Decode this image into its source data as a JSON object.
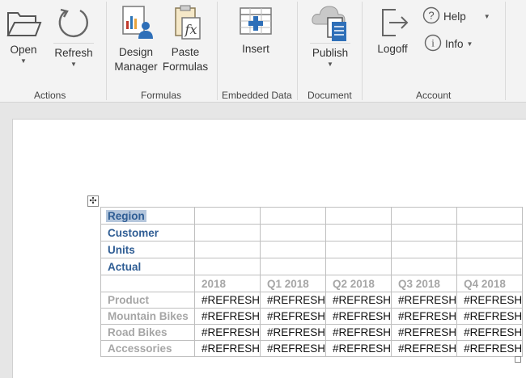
{
  "ribbon": {
    "groups": {
      "actions": "Actions",
      "formulas": "Formulas",
      "embedded": "Embedded Data",
      "document": "Document",
      "account": "Account"
    },
    "buttons": {
      "open": "Open",
      "refresh": "Refresh",
      "design_line1": "Design",
      "design_line2": "Manager",
      "paste_line1": "Paste",
      "paste_line2": "Formulas",
      "insert": "Insert",
      "publish": "Publish",
      "logoff": "Logoff",
      "help": "Help",
      "info": "Info"
    },
    "icons": [
      "folder-icon",
      "refresh-icon",
      "design-manager-icon",
      "paste-formulas-icon",
      "insert-table-icon",
      "cloud-publish-icon",
      "logoff-icon",
      "help-icon",
      "info-icon"
    ]
  },
  "table": {
    "row_headers": [
      "Region",
      "Customer",
      "Units",
      "Actual"
    ],
    "column_headers": [
      "2018",
      "Q1 2018",
      "Q2 2018",
      "Q3 2018",
      "Q4 2018"
    ],
    "data_rows": [
      {
        "label": "Product",
        "cells": [
          "#REFRESH",
          "#REFRESH",
          "#REFRESH",
          "#REFRESH",
          "#REFRESH"
        ]
      },
      {
        "label": "Mountain Bikes",
        "cells": [
          "#REFRESH",
          "#REFRESH",
          "#REFRESH",
          "#REFRESH",
          "#REFRESH"
        ]
      },
      {
        "label": "Road Bikes",
        "cells": [
          "#REFRESH",
          "#REFRESH",
          "#REFRESH",
          "#REFRESH",
          "#REFRESH"
        ]
      },
      {
        "label": "Accessories",
        "cells": [
          "#REFRESH",
          "#REFRESH",
          "#REFRESH",
          "#REFRESH",
          "#REFRESH"
        ]
      }
    ]
  },
  "colors": {
    "header_blue": "#2f5d94",
    "header_gray": "#a6a6a6",
    "selection": "#b4c6dc",
    "ribbon_bg": "#f3f3f3",
    "doc_bg": "#e6e6e6"
  }
}
